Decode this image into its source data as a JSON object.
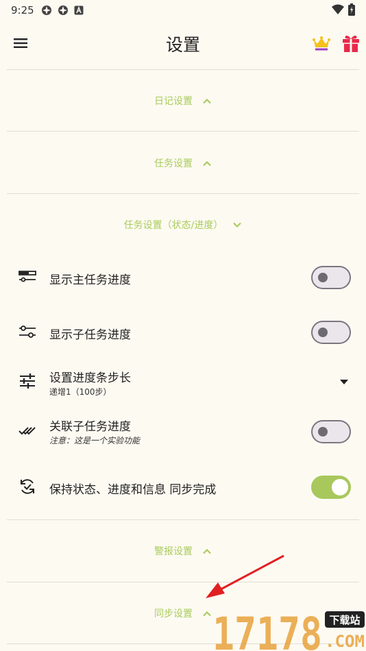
{
  "status_bar": {
    "time": "9:25"
  },
  "app_bar": {
    "title": "设置"
  },
  "sections": {
    "diary": {
      "label": "日记设置"
    },
    "task": {
      "label": "任务设置"
    },
    "task_status": {
      "label": "任务设置（状态/进度）"
    },
    "alarm": {
      "label": "警报设置"
    },
    "sync": {
      "label": "同步设置"
    }
  },
  "rows": [
    {
      "title": "显示主任务进度",
      "toggle": false
    },
    {
      "title": "显示子任务进度",
      "toggle": false
    },
    {
      "title": "设置进度条步长",
      "subtitle": "递增1（100步）"
    },
    {
      "title": "关联子任务进度",
      "subtitle": "注意：这是一个实验功能",
      "toggle": false
    },
    {
      "title": "保持状态、进度和信息 同步完成",
      "toggle": true
    }
  ],
  "watermark": {
    "number": "17178",
    "badge": "下载站",
    "domain": ".COM"
  },
  "colors": {
    "accent": "#a9cc5c",
    "background": "#fdfaf2",
    "toggle_on": "#a8c85c"
  }
}
